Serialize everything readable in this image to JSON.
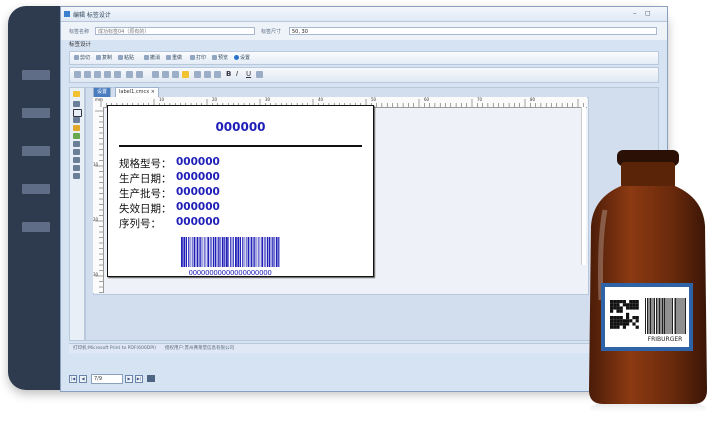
{
  "window": {
    "title": "编辑 标签设计"
  },
  "fields": {
    "name_label": "标签名称",
    "name_value": "成功标签04（原有的）",
    "size_label": "标签尺寸",
    "size_value": "50, 30"
  },
  "section_label": "标签设计",
  "toolbar": {
    "items": [
      "剪切",
      "复制",
      "粘贴",
      "撤消",
      "重做",
      "打印",
      "预览",
      "设置"
    ]
  },
  "tabs": [
    {
      "label": "设置"
    },
    {
      "label": "label1.cmcx ×"
    }
  ],
  "ruler": {
    "h_ticks": [
      "mm",
      "10",
      "20",
      "30",
      "40",
      "50",
      "60",
      "70",
      "80"
    ],
    "v_ticks": [
      "10",
      "20",
      "30"
    ]
  },
  "label": {
    "code": "000000",
    "rows": [
      {
        "key": "规格型号：",
        "value": "000000"
      },
      {
        "key": "生产日期：",
        "value": "000000"
      },
      {
        "key": "生产批号：",
        "value": "000000"
      },
      {
        "key": "失效日期：",
        "value": "000000"
      },
      {
        "key": "序列号：",
        "value": "000000"
      }
    ],
    "barcode_text": "00000000000000000000"
  },
  "status": {
    "printer": "打印机:Microsoft Print to PDF(600DPI)",
    "company": "授权用户:苏州弗莱堡信息有限公司"
  },
  "pager": {
    "page": "7/9"
  },
  "bottle_label": {
    "brand": "FRIBURGER"
  },
  "colors": {
    "frame": "#2e3a4d",
    "accent_blue": "#2020b8",
    "bottle": "#7a3210"
  }
}
